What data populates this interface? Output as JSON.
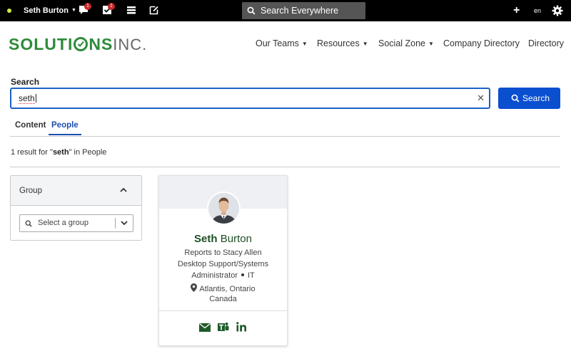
{
  "topbar": {
    "user_name": "Seth Burton",
    "messages_badge": "1",
    "tasks_badge": "1",
    "search_placeholder": "Search Everywhere",
    "add_label": "+",
    "language": "en"
  },
  "header": {
    "logo_main_a": "SOLUTI",
    "logo_main_b": "NS",
    "logo_inc": "INC.",
    "nav": [
      {
        "label": "Our Teams",
        "has_menu": true
      },
      {
        "label": "Resources",
        "has_menu": true
      },
      {
        "label": "Social Zone",
        "has_menu": true
      },
      {
        "label": "Company Directory",
        "has_menu": false
      },
      {
        "label": "Directory",
        "has_menu": false
      }
    ]
  },
  "search": {
    "label": "Search",
    "value": "seth",
    "button_label": "Search",
    "tabs": [
      "Content",
      "People"
    ],
    "active_tab": "People",
    "result_prefix": "1 result for \"",
    "result_term": "seth",
    "result_suffix": "\" in People"
  },
  "filter": {
    "title": "Group",
    "select_placeholder": "Select a group"
  },
  "person": {
    "first_name": "Seth",
    "last_name": "Burton",
    "reports_to": "Reports to Stacy Allen",
    "title_line1": "Desktop Support/Systems",
    "title_line2": "Administrator",
    "department": "IT",
    "location_line1": "Atlantis, Ontario",
    "location_line2": "Canada"
  },
  "colors": {
    "brand_green": "#2e8b3a",
    "accent_blue": "#0a4fcf",
    "icon_green": "#1e5a2a"
  }
}
